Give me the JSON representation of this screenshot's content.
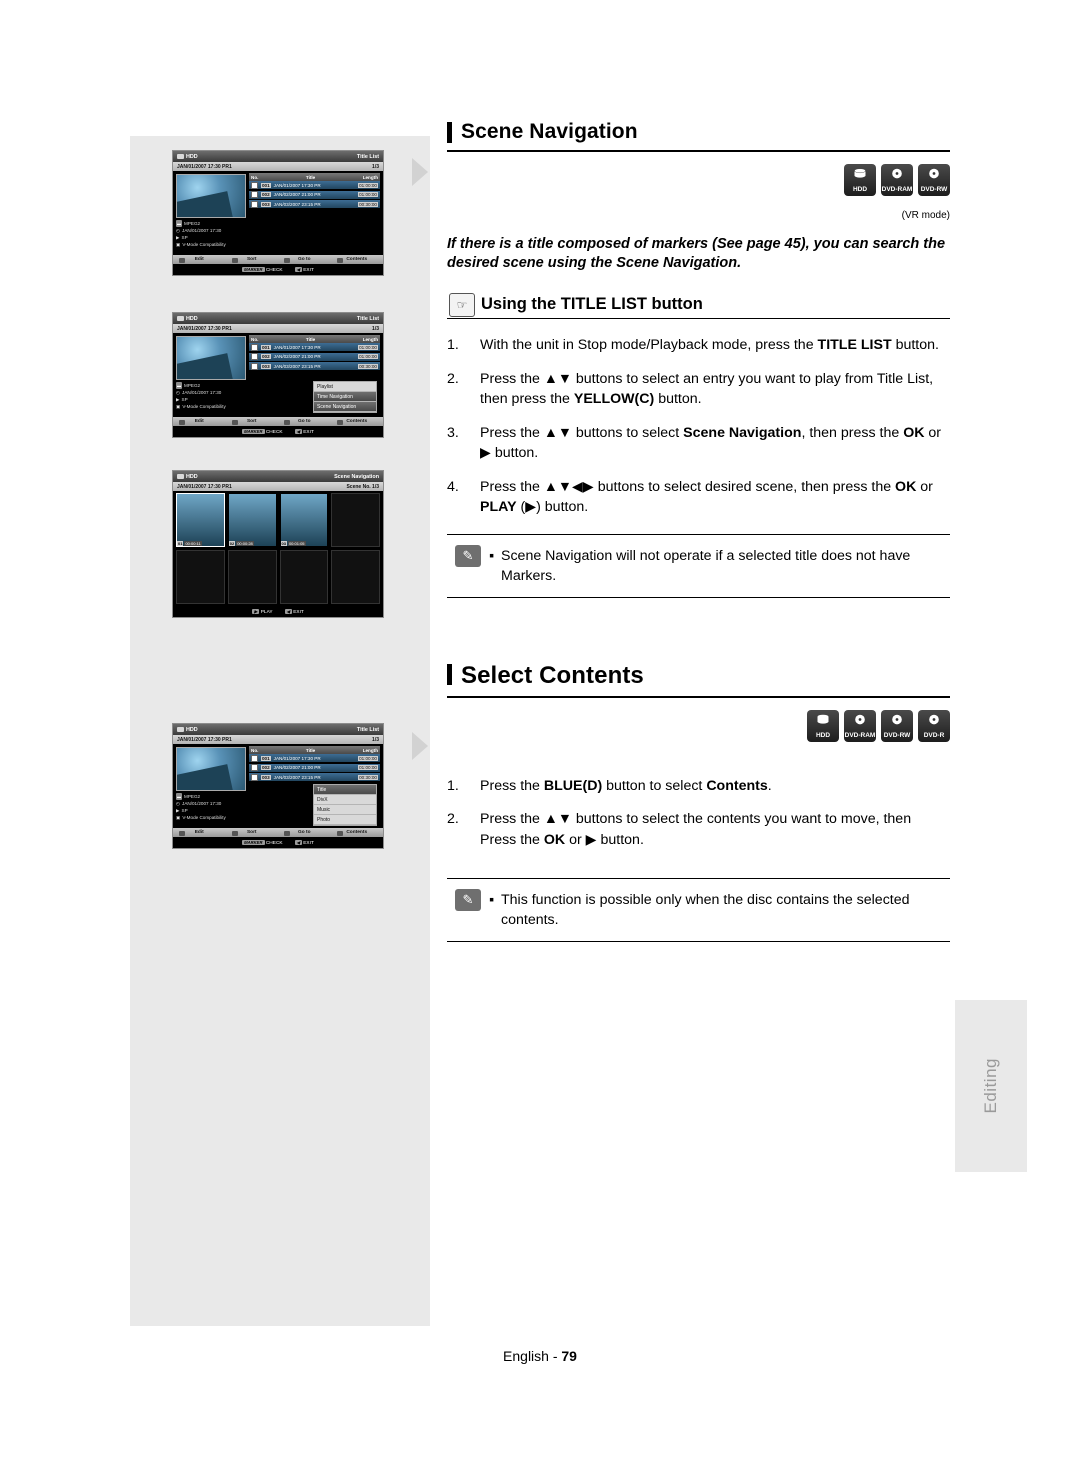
{
  "page": {
    "footer_prefix": "English -",
    "footer_number": "79",
    "side_tab": "Editing"
  },
  "section1": {
    "title": "Scene Navigation",
    "vr_mode": "(VR mode)",
    "disc_icons": [
      {
        "label": "HDD",
        "glyph": "hdd-icon"
      },
      {
        "label": "DVD-RAM",
        "glyph": "disc-icon"
      },
      {
        "label": "DVD-RW",
        "glyph": "disc-icon"
      }
    ],
    "intro": "If there is a title composed of markers (See page 45), you can search the desired scene using the Scene Navigation.",
    "sub_head": "Using the TITLE LIST button",
    "steps": [
      {
        "num": "1.",
        "text_html": "With the unit in Stop mode/Playback mode, press the <b>TITLE LIST</b> button."
      },
      {
        "num": "2.",
        "text_html": "Press the ▲▼ buttons to select an entry you want to play from Title List, then press the <b>YELLOW(C)</b> button."
      },
      {
        "num": "3.",
        "text_html": "Press the ▲▼ buttons to select <b>Scene Navigation</b>, then press the <b>OK</b> or ▶ button."
      },
      {
        "num": "4.",
        "text_html": "Press the ▲▼◀▶ buttons to select desired scene, then press the <b>OK</b> or <b>PLAY</b> (▶) button."
      }
    ],
    "note": "Scene Navigation will not operate if a selected title does not have Markers."
  },
  "section2": {
    "title": "Select Contents",
    "disc_icons": [
      {
        "label": "HDD",
        "glyph": "hdd-icon"
      },
      {
        "label": "DVD-RAM",
        "glyph": "disc-icon"
      },
      {
        "label": "DVD-RW",
        "glyph": "disc-icon"
      },
      {
        "label": "DVD-R",
        "glyph": "disc-icon"
      }
    ],
    "steps": [
      {
        "num": "1.",
        "text_html": "Press the <b>BLUE(D)</b> button to select <b>Contents</b>."
      },
      {
        "num": "2.",
        "text_html": "Press the ▲▼ buttons to select the contents you want to move, then Press the <b>OK</b> or ▶ button."
      }
    ],
    "note": "This function is possible only when the disc contains the selected contents."
  },
  "screens": {
    "titlelist1": {
      "source": "HDD",
      "header_right": "Title List",
      "date": "JAN/01/2007 17:30 PR1",
      "page": "1/3",
      "columns": [
        "No.",
        "Title",
        "Length"
      ],
      "rows": [
        {
          "no": "001",
          "title": "JAN/01/2007 17:30 PR",
          "length": "01:00:00"
        },
        {
          "no": "002",
          "title": "JAN/02/2007 21:00 PR",
          "length": "01:00:00"
        },
        {
          "no": "003",
          "title": "JAN/03/2007 23:15 PR",
          "length": "00:30:00"
        }
      ],
      "thumb_info": [
        "MPEG2",
        "JAN/01/2007 17:30",
        "SP",
        "V-Mode Compatibility"
      ],
      "footer": [
        "Edit",
        "Sort",
        "Go to",
        "Contents"
      ],
      "bottom": [
        "MARKER",
        "CHECK",
        "EXIT"
      ]
    },
    "titlelist2": {
      "source": "HDD",
      "header_right": "Title List",
      "date": "JAN/01/2007 17:30 PR1",
      "page": "1/3",
      "columns": [
        "No.",
        "Title",
        "Length"
      ],
      "rows": [
        {
          "no": "001",
          "title": "JAN/01/2007 17:30 PR",
          "length": "01:00:00"
        },
        {
          "no": "002",
          "title": "JAN/02/2007 21:00 PR",
          "length": "01:00:00"
        },
        {
          "no": "003",
          "title": "JAN/03/2007 23:15 PR",
          "length": "00:30:00"
        }
      ],
      "popup": [
        {
          "label": "Playlist",
          "selected": false
        },
        {
          "label": "Time Navigation",
          "selected": true
        },
        {
          "label": "Scene Navigation",
          "selected": true
        }
      ],
      "thumb_info": [
        "MPEG2",
        "JAN/01/2007 17:30",
        "SP",
        "V-Mode Compatibility"
      ],
      "footer": [
        "Edit",
        "Sort",
        "Go to",
        "Contents"
      ],
      "bottom": [
        "MARKER",
        "CHECK",
        "EXIT"
      ]
    },
    "scenenav": {
      "source": "HDD",
      "header_right": "Scene Navigation",
      "date": "JAN/01/2007 17:30 PR1",
      "scene_label": "Scene No.",
      "page": "1/3",
      "cells": [
        {
          "no": "01",
          "time": "00:00:11"
        },
        {
          "no": "02",
          "time": "00:00:28"
        },
        {
          "no": "03",
          "time": "00:01:05"
        }
      ],
      "bottom": [
        "PLAY",
        "EXIT"
      ]
    },
    "contents": {
      "source": "HDD",
      "header_right": "Title List",
      "date": "JAN/01/2007 17:30 PR1",
      "page": "1/3",
      "columns": [
        "No.",
        "Title",
        "Length"
      ],
      "rows": [
        {
          "no": "001",
          "title": "JAN/01/2007 17:30 PR",
          "length": "01:00:00"
        },
        {
          "no": "002",
          "title": "JAN/02/2007 21:00 PR",
          "length": "01:00:00"
        },
        {
          "no": "003",
          "title": "JAN/03/2007 23:15 PR",
          "length": "00:30:00"
        }
      ],
      "popup": [
        {
          "label": "Title",
          "selected": true
        },
        {
          "label": "DivX",
          "selected": false
        },
        {
          "label": "Music",
          "selected": false
        },
        {
          "label": "Photo",
          "selected": false
        }
      ],
      "thumb_info": [
        "MPEG2",
        "JAN/01/2007 17:30",
        "SP",
        "V-Mode Compatibility"
      ],
      "footer": [
        "Edit",
        "Sort",
        "Go to",
        "Contents"
      ],
      "bottom": [
        "MARKER",
        "CHECK",
        "EXIT"
      ]
    }
  }
}
